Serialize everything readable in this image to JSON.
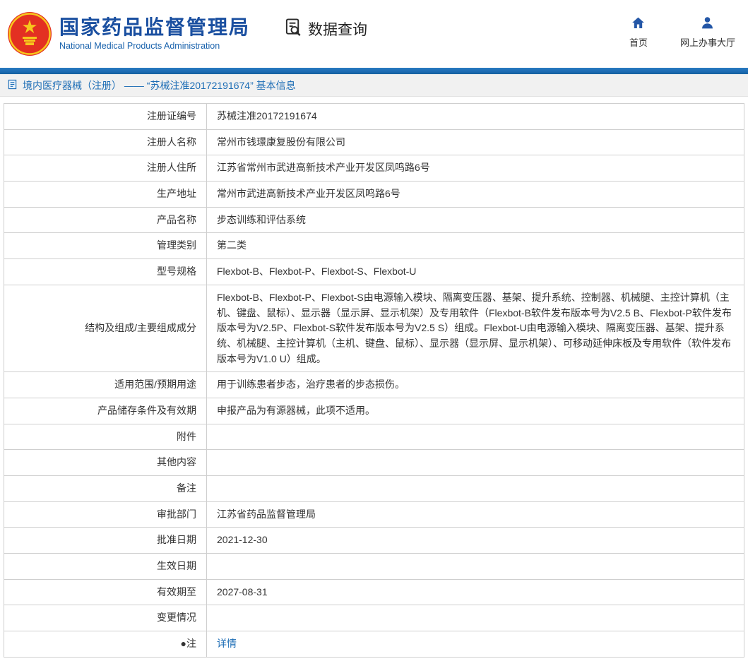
{
  "header": {
    "org_name_zh": "国家药品监督管理局",
    "org_name_en": "National Medical Products Administration",
    "section_title": "数据查询",
    "nav_home": "首页",
    "nav_service_hall": "网上办事大厅"
  },
  "breadcrumb": {
    "text": "境内医疗器械（注册） —— “苏械注准20172191674” 基本信息"
  },
  "colors": {
    "accent_blue": "#1b6cb5",
    "title_blue": "#1a4fa0",
    "emblem_red": "#e33022",
    "emblem_gold": "#f7c71c",
    "link_blue": "#1b6cb5"
  },
  "table": {
    "rows": [
      {
        "label": "注册证编号",
        "value": "苏械注准20172191674"
      },
      {
        "label": "注册人名称",
        "value": "常州市钱璟康复股份有限公司"
      },
      {
        "label": "注册人住所",
        "value": "江苏省常州市武进高新技术产业开发区凤鸣路6号"
      },
      {
        "label": "生产地址",
        "value": "常州市武进高新技术产业开发区凤鸣路6号"
      },
      {
        "label": "产品名称",
        "value": "步态训练和评估系统"
      },
      {
        "label": "管理类别",
        "value": "第二类"
      },
      {
        "label": "型号规格",
        "value": "Flexbot-B、Flexbot-P、Flexbot-S、Flexbot-U"
      },
      {
        "label": "结构及组成/主要组成成分",
        "value": "Flexbot-B、Flexbot-P、Flexbot-S由电源输入模块、隔离变压器、基架、提升系统、控制器、机械腿、主控计算机（主机、键盘、鼠标）、显示器（显示屏、显示机架）及专用软件（Flexbot-B软件发布版本号为V2.5 B、Flexbot-P软件发布版本号为V2.5P、Flexbot-S软件发布版本号为V2.5 S）组成。Flexbot-U由电源输入模块、隔离变压器、基架、提升系统、机械腿、主控计算机（主机、键盘、鼠标）、显示器（显示屏、显示机架）、可移动延伸床板及专用软件（软件发布版本号为V1.0 U）组成。"
      },
      {
        "label": "适用范围/预期用途",
        "value": "用于训练患者步态，治疗患者的步态损伤。"
      },
      {
        "label": "产品储存条件及有效期",
        "value": "申报产品为有源器械，此项不适用。"
      },
      {
        "label": "附件",
        "value": ""
      },
      {
        "label": "其他内容",
        "value": ""
      },
      {
        "label": "备注",
        "value": ""
      },
      {
        "label": "审批部门",
        "value": "江苏省药品监督管理局"
      },
      {
        "label": "批准日期",
        "value": "2021-12-30"
      },
      {
        "label": "生效日期",
        "value": ""
      },
      {
        "label": "有效期至",
        "value": "2027-08-31"
      },
      {
        "label": "变更情况",
        "value": ""
      },
      {
        "label": "●注",
        "value": "详情",
        "link": true
      }
    ]
  }
}
